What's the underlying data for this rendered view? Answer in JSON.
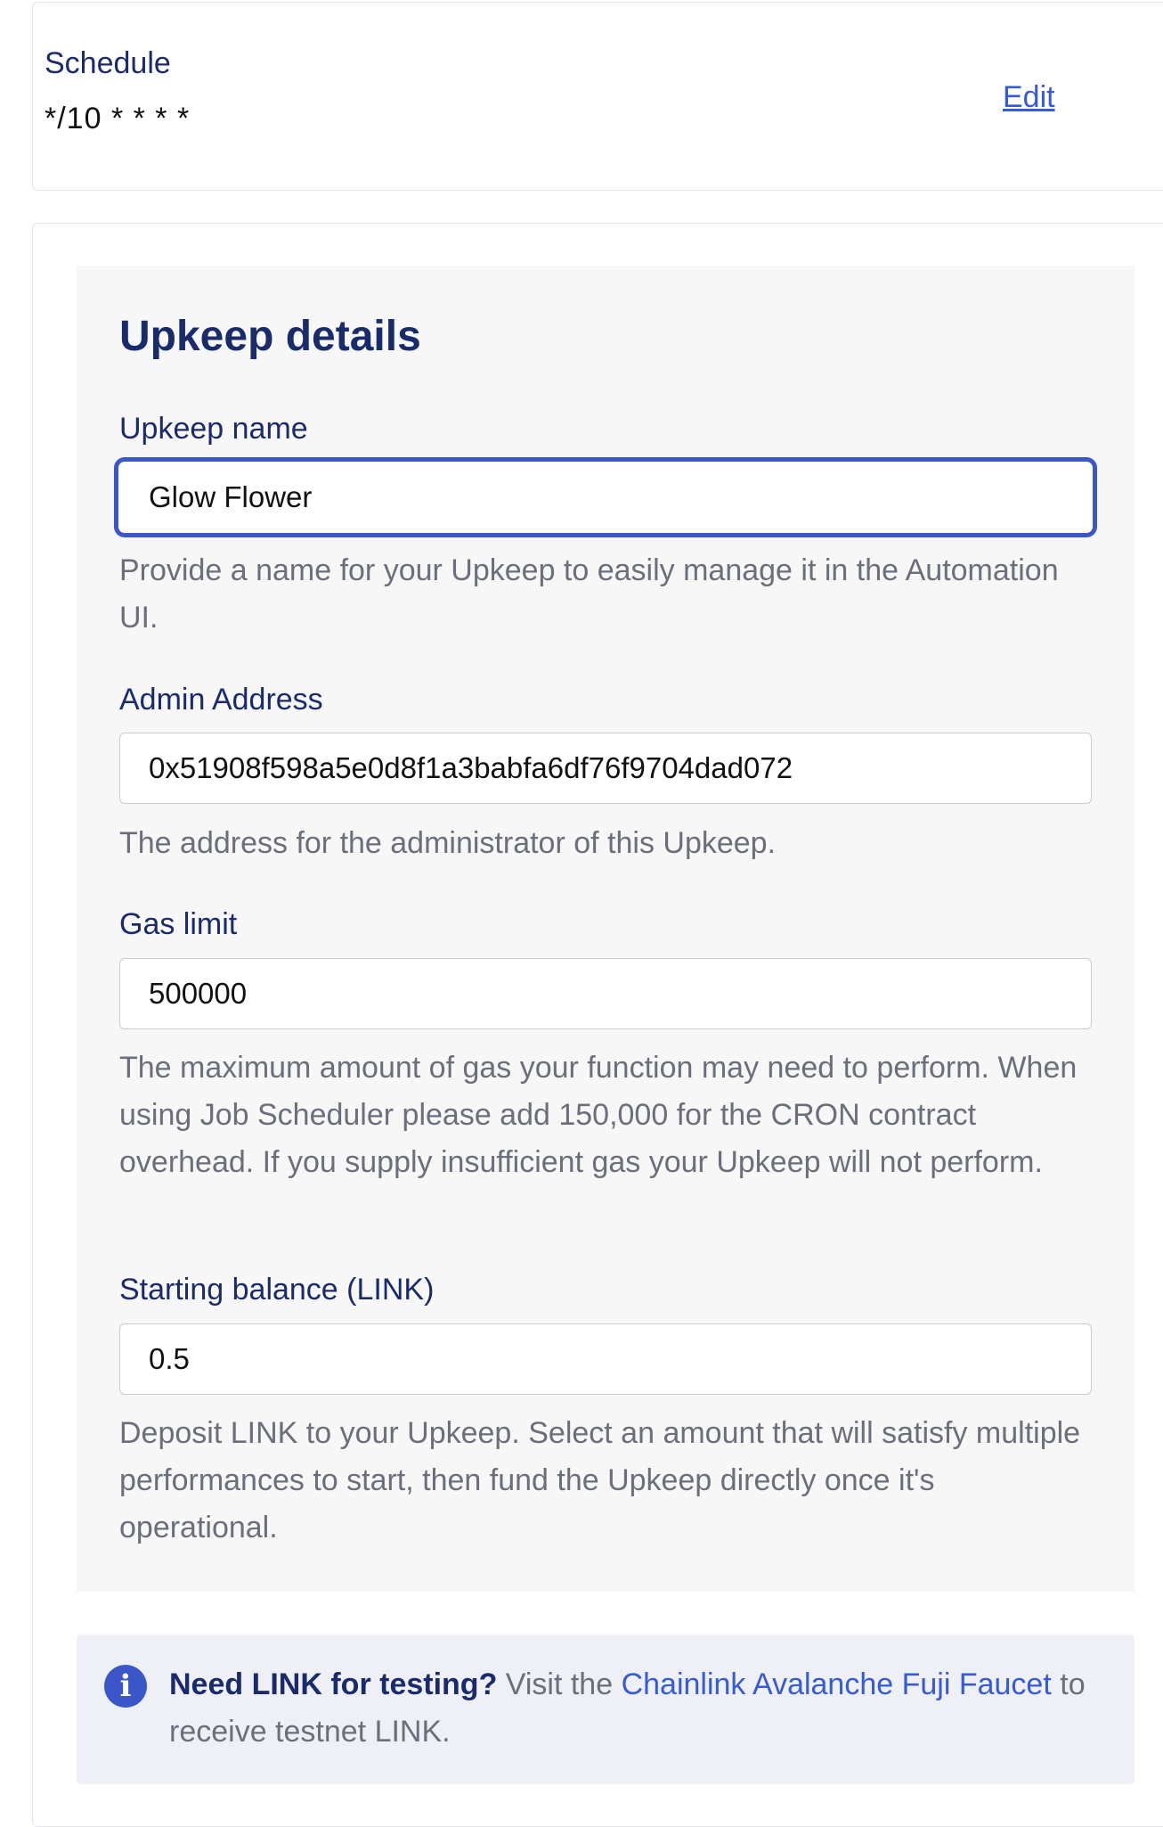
{
  "schedule": {
    "label": "Schedule",
    "value": "*/10 * * * *",
    "edit_label": "Edit"
  },
  "upkeep_details": {
    "title": "Upkeep details",
    "name": {
      "label": "Upkeep name",
      "value": "Glow Flower",
      "help": "Provide a name for your Upkeep to easily manage it in the Automation UI."
    },
    "admin_address": {
      "label": "Admin Address",
      "value": "0x51908f598a5e0d8f1a3babfa6df76f9704dad072",
      "help": "The address for the administrator of this Upkeep."
    },
    "gas_limit": {
      "label": "Gas limit",
      "value": "500000",
      "help": "The maximum amount of gas your function may need to perform. When using Job Scheduler please add 150,000 for the CRON contract overhead. If you supply insufficient gas your Upkeep will not perform."
    },
    "starting_balance": {
      "label": "Starting balance (LINK)",
      "value": "0.5",
      "help": "Deposit LINK to your Upkeep. Select an amount that will satisfy multiple performances to start, then fund the Upkeep directly once it's operational."
    }
  },
  "notice": {
    "icon": "info-icon",
    "icon_glyph": "i",
    "strong": "Need LINK for testing?",
    "pre_link": " Visit the ",
    "link": "Chainlink Avalanche Fuji Faucet",
    "post_link": " to receive testnet LINK."
  },
  "colors": {
    "heading": "#1a2b6b",
    "link": "#375bd2",
    "focus_border": "#3b56c9",
    "help_text": "#6b6f7b",
    "panel_bg": "#f7f7f8",
    "notice_bg": "#eef0f6"
  }
}
